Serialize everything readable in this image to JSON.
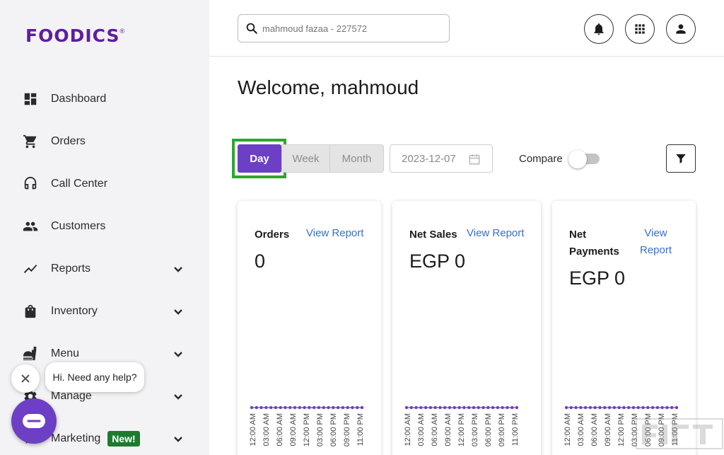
{
  "brand": {
    "logo_text": "FOODICS",
    "logo_mark": "®",
    "accent": "#6c3fc4",
    "logo_color": "#5e1ea0"
  },
  "sidebar": {
    "items": [
      {
        "label": "Dashboard",
        "icon": "dashboard-icon",
        "chevron": false
      },
      {
        "label": "Orders",
        "icon": "cart-icon",
        "chevron": false
      },
      {
        "label": "Call Center",
        "icon": "headset-icon",
        "chevron": false
      },
      {
        "label": "Customers",
        "icon": "people-icon",
        "chevron": false
      },
      {
        "label": "Reports",
        "icon": "trend-icon",
        "chevron": true
      },
      {
        "label": "Inventory",
        "icon": "bag-icon",
        "chevron": true
      },
      {
        "label": "Menu",
        "icon": "food-icon",
        "chevron": true
      },
      {
        "label": "Manage",
        "icon": "gear-icon",
        "chevron": true
      },
      {
        "label": "Marketing",
        "icon": "megaphone-icon",
        "chevron": true,
        "badge": "New!"
      }
    ]
  },
  "header": {
    "search_value": "mahmoud fazaa - 227572",
    "buttons": [
      "notifications-icon",
      "apps-grid-icon",
      "account-icon"
    ]
  },
  "main": {
    "welcome": "Welcome, mahmoud",
    "period_tabs": [
      "Day",
      "Week",
      "Month"
    ],
    "selected_period": "Day",
    "date_value": "2023-12-07",
    "compare_label": "Compare",
    "compare_enabled": false,
    "cards": [
      {
        "title": "Orders",
        "link": "View Report",
        "value": "0"
      },
      {
        "title": "Net Sales",
        "link": "View Report",
        "value": "EGP 0"
      },
      {
        "title_line1": "Net",
        "title_line2": "Payments",
        "link_line1": "View",
        "link_line2": "Report",
        "value": "EGP 0"
      }
    ]
  },
  "chart_data": {
    "type": "line",
    "x": [
      "12:00 AM",
      "03:00 AM",
      "06:00 AM",
      "09:00 AM",
      "12:00 PM",
      "03:00 PM",
      "06:00 PM",
      "09:00 PM",
      "11:00 PM"
    ],
    "series": [
      {
        "values": [
          0,
          0,
          0,
          0,
          0,
          0,
          0,
          0,
          0
        ]
      }
    ],
    "points_per_series": 24,
    "color": "#6c3fc4"
  },
  "chat": {
    "message": "Hi. Need any help?"
  }
}
